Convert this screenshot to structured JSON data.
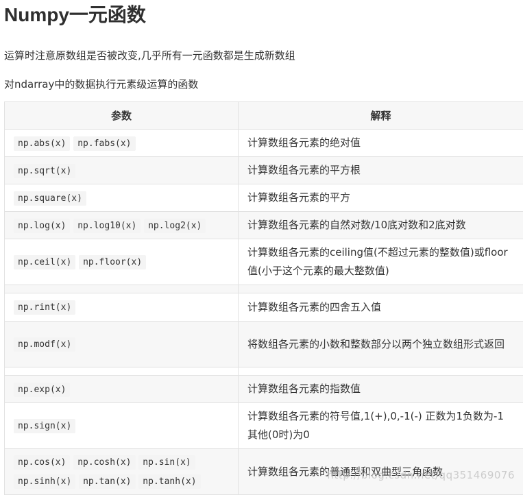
{
  "title": "Numpy一元函数",
  "paragraphs": [
    "运算时注意原数组是否被改变,几乎所有一元函数都是生成新数组",
    "对ndarray中的数据执行元素级运算的函数"
  ],
  "table": {
    "headers": [
      "参数",
      "解释"
    ],
    "rows": [
      {
        "codes": [
          "np.abs(x)",
          "np.fabs(x)"
        ],
        "desc": "计算数组各元素的绝对值"
      },
      {
        "codes": [
          "np.sqrt(x)"
        ],
        "desc": "计算数组各元素的平方根"
      },
      {
        "codes": [
          "np.square(x)"
        ],
        "desc": "计算数组各元素的平方"
      },
      {
        "codes": [
          "np.log(x)",
          "np.log10(x)",
          "np.log2(x)"
        ],
        "desc": "计算数组各元素的自然对数/10底对数和2底对数"
      },
      {
        "codes": [
          "np.ceil(x)",
          "np.floor(x)"
        ],
        "desc": "计算数组各元素的ceiling值(不超过元素的整数值)或floor值(小于这个元素的最大整数值)"
      },
      {
        "codes": [],
        "desc": ""
      },
      {
        "codes": [
          "np.rint(x)"
        ],
        "desc": "计算数组各元素的四舍五入值"
      },
      {
        "codes": [
          "np.modf(x)"
        ],
        "desc": "将数组各元素的小数和整数部分以两个独立数组形式返回"
      },
      {
        "codes": [],
        "desc": ""
      },
      {
        "codes": [
          "np.exp(x)"
        ],
        "desc": "计算数组各元素的指数值"
      },
      {
        "codes": [
          "np.sign(x)"
        ],
        "desc": "计算数组各元素的符号值,1(+),0,-1(-) 正数为1负数为-1 其他(0时)为0"
      },
      {
        "codes": [
          "np.cos(x)",
          "np.cosh(x)",
          "np.sin(x)",
          "np.sinh(x)",
          "np.tan(x)",
          "np.tanh(x)"
        ],
        "desc": "计算数组各元素的普通型和双曲型三角函数"
      }
    ]
  },
  "watermark": "http://blog.csdn.net/qq351469076"
}
